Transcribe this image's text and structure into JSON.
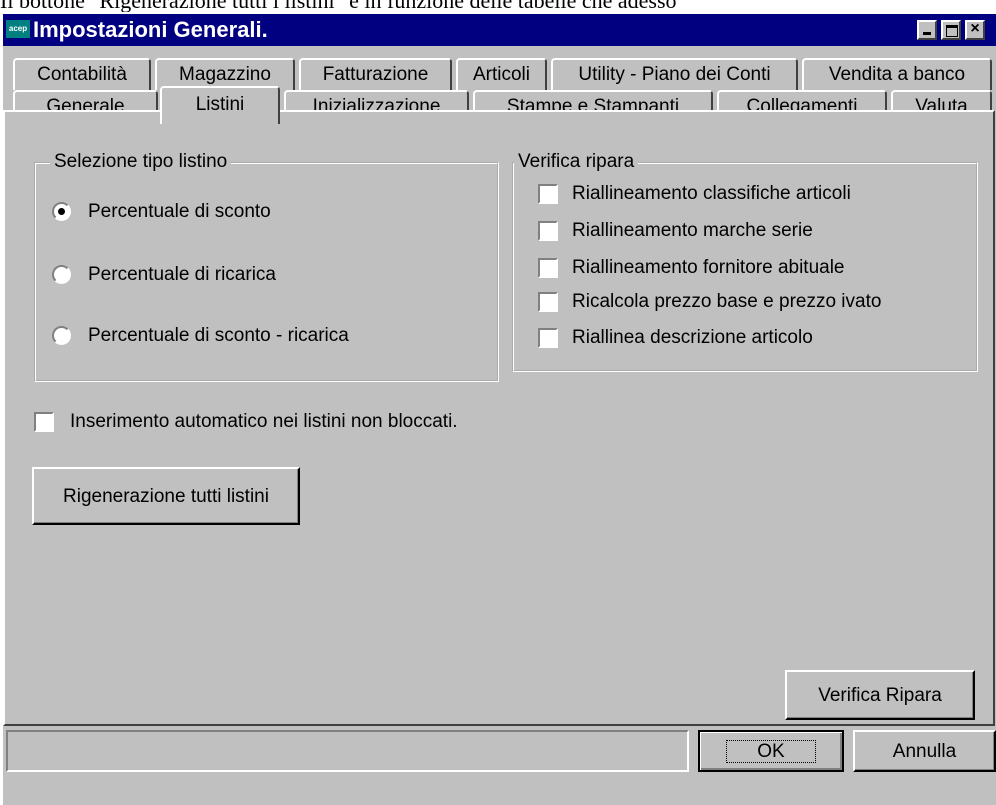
{
  "caption": "Il bottone \"Rigenerazione tutti i listini\" e in funzione delle tabelle che adesso",
  "window": {
    "title": "Impostazioni Generali.",
    "logo": "acep",
    "controls": {
      "minimize": "minimize-icon",
      "maximize": "maximize-icon",
      "close": "×"
    }
  },
  "tabs": {
    "row1": [
      "Contabilità",
      "Magazzino",
      "Fatturazione",
      "Articoli",
      "Utility - Piano dei Conti",
      "Vendita a banco"
    ],
    "row2": [
      "Generale",
      "Listini",
      "Inizializzazione",
      "Stampe e Stampanti",
      "Collegamenti",
      "Valuta"
    ],
    "active": "Listini"
  },
  "selezione": {
    "title": "Selezione tipo listino",
    "options": [
      "Percentuale di sconto",
      "Percentuale di ricarica",
      "Percentuale di sconto - ricarica"
    ],
    "selected": "Percentuale di sconto"
  },
  "verifica": {
    "title": "Verifica ripara",
    "items": [
      "Riallineamento classifiche articoli",
      "Riallineamento marche serie",
      "Riallineamento fornitore abituale",
      "Ricalcola prezzo base e prezzo ivato",
      "Riallinea descrizione articolo"
    ]
  },
  "auto_insert_label": "Inserimento automatico nei listini non bloccati.",
  "buttons": {
    "rigenerazione": "Rigenerazione tutti listini",
    "verifica_ripara": "Verifica Ripara",
    "ok": "OK",
    "annulla": "Annulla"
  },
  "colors": {
    "titlebar": "#000080",
    "face": "#c0c0c0",
    "logo": "#008080"
  }
}
